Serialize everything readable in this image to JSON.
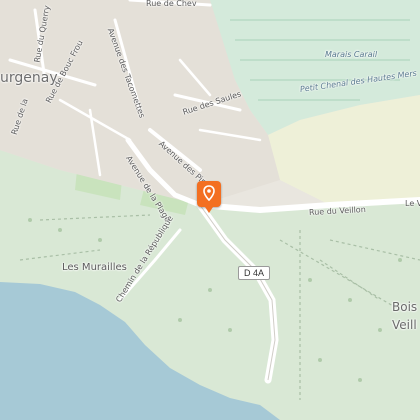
{
  "map": {
    "colors": {
      "land": "#e9e6df",
      "forest": "#d9e8d5",
      "park": "#c9e3bd",
      "water": "#a6c9d6",
      "marsh": "#d7ead9",
      "road": "#ffffff",
      "building": "#d8d3cb",
      "marker": "#f36f21"
    },
    "labels": {
      "town": "urgenay",
      "rue_de_chev": "Rue de Chev",
      "rue_du_querry": "Rue du Querry",
      "avenue_des_tacomettes": "Avenue des Tacomettes",
      "rue_de_bouc_frou": "Rue de Bouc Frou",
      "rue_de_la": "Rue de la",
      "rue_des_saules": "Rue des Saules",
      "avenue_des_pins": "Avenue des Pins",
      "avenue_de_la_plage": "Avenue de la Plage",
      "rue_du_veillon": "Rue du Veillon",
      "le_v": "Le V",
      "marais_carail": "Marais Carail",
      "petit_chenal": "Petit Chenal des Hautes Mers",
      "les_murailles": "Les Murailles",
      "chemin_republique": "Chemin de la République",
      "road_badge": "D 4A",
      "bois": "Bois",
      "veill": "Veill"
    },
    "marker_icon": "map-pin-icon"
  }
}
